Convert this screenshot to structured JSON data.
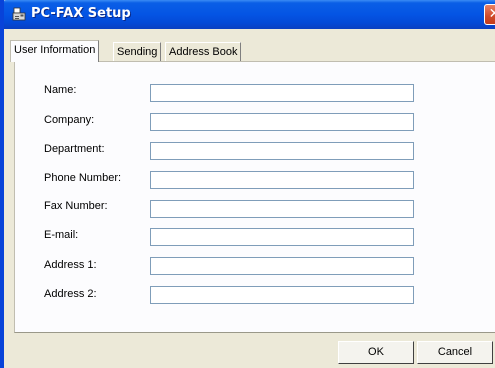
{
  "window": {
    "title": "PC-FAX Setup",
    "close_glyph": "✕"
  },
  "colors": {
    "titlebar": "#0454e4",
    "dialog_bg": "#ece9d8",
    "panel_bg": "#fcfcfe",
    "input_border": "#7f9db9"
  },
  "icons": {
    "app": "fax-icon",
    "close": "close-icon"
  },
  "tabs": [
    {
      "label": "User Information",
      "active": true
    },
    {
      "label": "Sending",
      "active": false
    },
    {
      "label": "Address Book",
      "active": false
    }
  ],
  "fields": [
    {
      "label": "Name:",
      "value": ""
    },
    {
      "label": "Company:",
      "value": ""
    },
    {
      "label": "Department:",
      "value": ""
    },
    {
      "label": "Phone Number:",
      "value": ""
    },
    {
      "label": "Fax Number:",
      "value": ""
    },
    {
      "label": "E-mail:",
      "value": ""
    },
    {
      "label": "Address 1:",
      "value": ""
    },
    {
      "label": "Address 2:",
      "value": ""
    }
  ],
  "buttons": {
    "ok": "OK",
    "cancel": "Cancel"
  }
}
